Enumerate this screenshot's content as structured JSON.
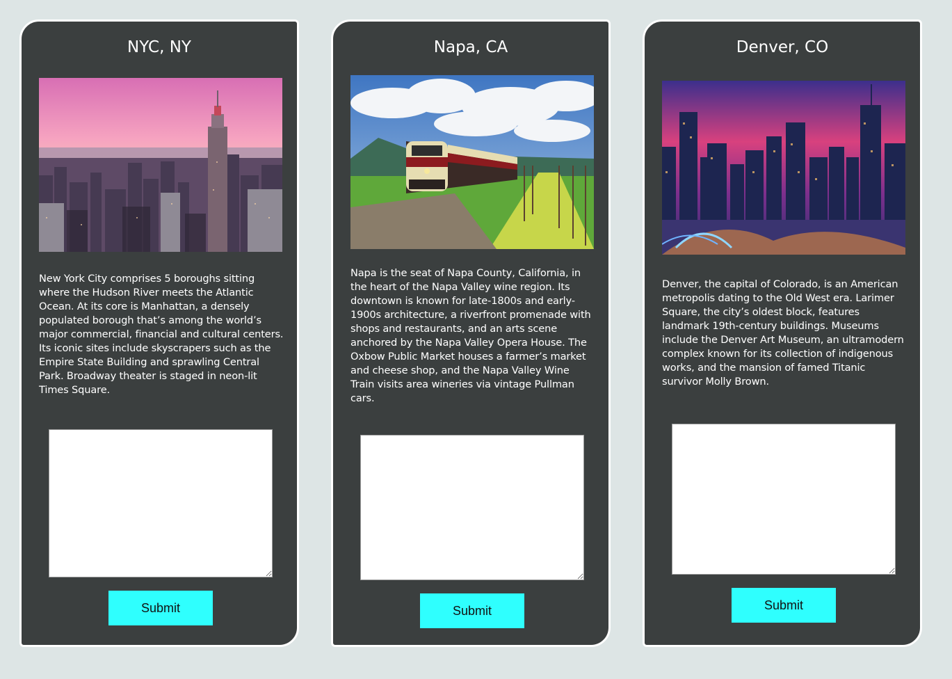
{
  "colors": {
    "page_background": "#dde5e5",
    "card_background": "#3b3f3f",
    "card_border": "#ffffff",
    "text": "#ffffff",
    "button_background": "#2ffffe",
    "button_text": "#111111"
  },
  "cards": [
    {
      "title": "NYC, NY",
      "photo_icon": "nyc-skyline-photo",
      "description": "New York City comprises 5 boroughs sitting where the Hudson River meets the Atlantic Ocean. At its core is Manhattan, a densely populated borough that’s among the world’s major commercial, financial and cultural centers. Its iconic sites include skyscrapers such as the Empire State Building and sprawling Central Park. Broadway theater is staged in neon-lit Times Square.",
      "comment_value": "",
      "submit_label": "Submit"
    },
    {
      "title": "Napa, CA",
      "photo_icon": "napa-wine-train-photo",
      "description": "Napa is the seat of Napa County, California, in the heart of the Napa Valley wine region. Its downtown is known for late-1800s and early-1900s architecture, a riverfront promenade with shops and restaurants, and an arts scene anchored by the Napa Valley Opera House. The Oxbow Public Market houses a farmer’s market and cheese shop, and the Napa Valley Wine Train visits area wineries via vintage Pullman cars.",
      "comment_value": "",
      "submit_label": "Submit"
    },
    {
      "title": "Denver, CO",
      "photo_icon": "denver-skyline-photo",
      "description": "Denver, the capital of Colorado, is an American metropolis dating to the Old West era. Larimer Square, the city’s oldest block, features landmark 19th-century buildings. Museums include the Denver Art Museum, an ultramodern complex known for its collection of indigenous works, and the mansion of famed Titanic survivor Molly Brown.",
      "comment_value": "",
      "submit_label": "Submit"
    }
  ]
}
